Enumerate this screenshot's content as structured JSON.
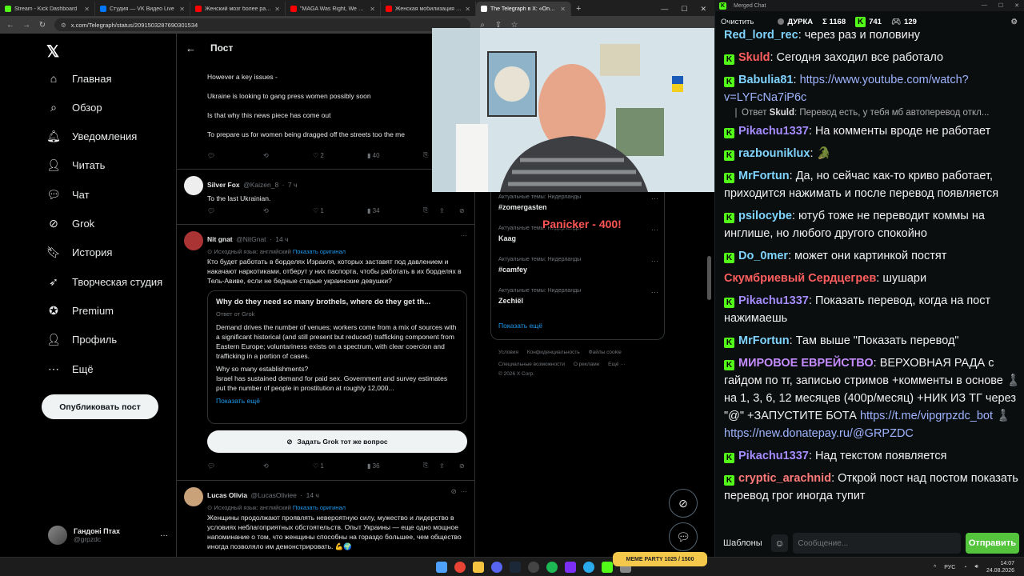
{
  "browser": {
    "tabs": [
      {
        "label": "Stream - Kick Dashboard",
        "color": "#53fc18"
      },
      {
        "label": "Студия — VK Видео Live",
        "color": "#0077ff"
      },
      {
        "label": "Женский мозг более развит",
        "color": "#ff0000"
      },
      {
        "label": "\"MAGA Was Right, We Were C",
        "color": "#ff0000"
      },
      {
        "label": "Женская мобилизация совсе",
        "color": "#ff0000"
      },
      {
        "label": "The Telegraph в X: «One of the",
        "color": "#ffffff",
        "active": true
      }
    ],
    "url": "x.com/Telegraph/status/2091503287690301534"
  },
  "leftnav": {
    "items": [
      {
        "label": "Главная",
        "icon": "home-icon",
        "glyph": "⌂"
      },
      {
        "label": "Обзор",
        "icon": "search-icon",
        "glyph": "⌕"
      },
      {
        "label": "Уведомления",
        "icon": "bell-icon",
        "glyph": "🔔︎"
      },
      {
        "label": "Читать",
        "icon": "follow-icon",
        "glyph": "👤︎"
      },
      {
        "label": "Чат",
        "icon": "chat-icon",
        "glyph": "💬︎"
      },
      {
        "label": "Grok",
        "icon": "grok-icon",
        "glyph": "⊘"
      },
      {
        "label": "История",
        "icon": "bookmark-icon",
        "glyph": "🔖︎"
      },
      {
        "label": "Творческая студия",
        "icon": "rocket-icon",
        "glyph": "➶"
      },
      {
        "label": "Premium",
        "icon": "premium-icon",
        "glyph": "✪"
      },
      {
        "label": "Профиль",
        "icon": "profile-icon",
        "glyph": "👤︎"
      },
      {
        "label": "Ещё",
        "icon": "more-icon",
        "glyph": "⋯"
      }
    ],
    "post_button": "Опубликовать пост",
    "profile": {
      "name": "Гандоні Птах",
      "handle": "@grpzdc"
    }
  },
  "feed": {
    "title": "Пост",
    "main_lines": [
      "However a key issues -",
      "Ukraine is looking to gang press women possibly soon",
      "Is that why this news piece has come out",
      "To prepare us for women being dragged off the streets too the me"
    ],
    "main_stats": {
      "likes": "2",
      "views": "40"
    },
    "reply1": {
      "name": "Silver Fox",
      "handle": "@Kaizen_8",
      "time": "7 ч",
      "text": "To the last Ukrainian.",
      "likes": "1",
      "views": "34"
    },
    "reply2": {
      "name": "Nit gnat",
      "handle": "@NitGnat",
      "time": "14 ч",
      "translated_note": "Исходный язык: английский",
      "show_original": "Показать оригинал",
      "text": "Кто будет работать в борделях Израиля, которых заставят под давлением и накачают наркотиками, отберут у них паспорта, чтобы работать в их борделях в Тель-Авиве, если не бедные старые украинские девушки?",
      "grok": {
        "title": "Why do they need so many brothels, where do they get th...",
        "subtitle": "Ответ от Grok",
        "p1": "Demand drives the number of venues; workers come from a mix of sources with a significant historical (and still present but reduced) trafficking component from Eastern Europe; voluntariness exists on a spectrum, with clear coercion and trafficking in a portion of cases.",
        "p2": "Why so many establishments?",
        "p3": "Israel has sustained demand for paid sex. Government and survey estimates put the number of people in prostitution at roughly 12,000...",
        "more": "Показать ещё"
      },
      "ask_grok": "Задать Grok тот же вопрос",
      "likes": "1",
      "views": "36"
    },
    "reply3": {
      "name": "Lucas Olivia",
      "handle": "@LucasOliviee",
      "time": "14 ч",
      "translated_note": "Исходный язык: английский",
      "show_original": "Показать оригинал",
      "text": "Женщины продолжают проявлять невероятную силу, мужество и лидерство в условиях неблагоприятных обстоятельств. Опыт Украины — еще одно мощное напоминание о том, что женщины способны на гораздо большее, чем общество иногда позволяло им демонстрировать. 💪🌍"
    }
  },
  "trends": {
    "items": [
      {
        "category": "Актуальные темы: Нидерланды",
        "name": "#zomergasten"
      },
      {
        "category": "Актуальные темы: Нидерланды",
        "name": "Kaag"
      },
      {
        "category": "Актуальные темы: Нидерланды",
        "name": "#camfey"
      },
      {
        "category": "Актуальные темы: Нидерланды",
        "name": "Zechiël"
      }
    ],
    "show_more": "Показать ещё",
    "footer1": "Условия      Конфиденциальность      Файлы cookie",
    "footer2": "Специальные возможности      О рекламе      Ещё ···",
    "footer3": "© 2026 X Corp."
  },
  "overlay": {
    "text": "Panicker - 400!",
    "color": "#ff5555"
  },
  "chat": {
    "window_title": "Merged Chat",
    "clear": "Очистить",
    "streamer": "ДУРКА",
    "sigma": "Σ 1168",
    "kick_count": "741",
    "second_count": "129",
    "messages": [
      {
        "user": "Red_lord_rec",
        "color": "#7fd3ff",
        "text": "через раз и половину",
        "kick": false
      },
      {
        "user": "Skuld",
        "color": "#ff5e5e",
        "text": "Сегодня заходил все работало",
        "kick": true
      },
      {
        "user": "Babulia81",
        "color": "#7fd3ff",
        "text": "",
        "link": "https://www.youtube.com/watch?v=LYFcNa7iP6c",
        "kick": true
      },
      {
        "user": "Pikachu1337",
        "color": "#a58cff",
        "text": "На комменты вроде не работает",
        "kick": true,
        "reply": {
          "user": "Skuld",
          "text": "Перевод есть, у тебя мб автоперевод откл..."
        }
      },
      {
        "user": "razbouniklux",
        "color": "#7fd3ff",
        "text": "🐊",
        "kick": true
      },
      {
        "user": "MrFortun",
        "color": "#7fd3ff",
        "text": "Да, но сейчас как-то криво работает, приходится нажимать и после перевод появляется",
        "kick": true
      },
      {
        "user": "psilocybe",
        "color": "#7fd3ff",
        "text": "ютуб тоже не переводит коммы на инглише, но любого другого спокойно",
        "kick": true
      },
      {
        "user": "Do_0mer",
        "color": "#7fd3ff",
        "text": "может они картинкой постят",
        "kick": true
      },
      {
        "user": "Скумбриевый Сердцегрев",
        "color": "#ff5e5e",
        "text": "шушари",
        "kick": false
      },
      {
        "user": "Pikachu1337",
        "color": "#a58cff",
        "text": "Показать перевод, когда на пост нажимаешь",
        "kick": true
      },
      {
        "user": "MrFortun",
        "color": "#7fd3ff",
        "text": "Там выше \"Показать перевод\"",
        "kick": true
      },
      {
        "user": "МИРОВОЕ ЕВРЕЙСТВО",
        "color": "#c58cff",
        "text": "ВЕРХОВНАЯ РАДА с гайдом по тг, записью стримов +комменты в основе ♟️ на 1, 3, 6, 12 месяцев (400р/месяц) +НИК ИЗ ТГ через \"@\" +ЗАПУСТИТЕ БОТА",
        "link": "https://t.me/vipgrpzdc_bot ♟️ https://new.donatepay.ru/@GRPZDC",
        "kick": true
      },
      {
        "user": "Pikachu1337",
        "color": "#a58cff",
        "text": "Над текстом появляется",
        "kick": true
      },
      {
        "user": "cryptic_arachnid",
        "color": "#ff7a7a",
        "text": "Открой пост над постом показать перевод грог иногда тупит",
        "kick": true
      }
    ],
    "templates": "Шаблоны",
    "input_placeholder": "Сообщение...",
    "send": "Отправить"
  },
  "taskbar": {
    "lang": "РУС",
    "time": "14:07",
    "date": "24.08.2026",
    "meme_party": "MEME PARTY 1025 / 1500"
  }
}
